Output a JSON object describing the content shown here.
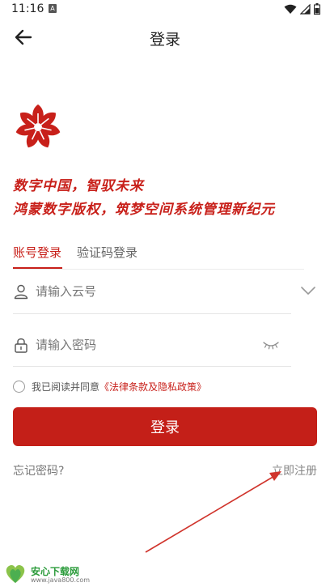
{
  "status_bar": {
    "time": "11:16",
    "notification_badge": "A"
  },
  "nav": {
    "title": "登录"
  },
  "slogan": {
    "line1": "数字中国，智驭未来",
    "line2": "鸿蒙数字版权，筑梦空间系统管理新纪元"
  },
  "tabs": [
    {
      "label": "账号登录",
      "active": true
    },
    {
      "label": "验证码登录",
      "active": false
    }
  ],
  "form": {
    "account_placeholder": "请输入云号",
    "account_value": "",
    "password_placeholder": "请输入密码",
    "password_value": ""
  },
  "agreement": {
    "checked": false,
    "prefix": "我已阅读并同意",
    "link": "《法律条款及隐私政策》"
  },
  "login_button": "登录",
  "links": {
    "forgot": "忘记密码?",
    "register": "立即注册"
  },
  "watermark": {
    "title": "安心下载网",
    "url": "www.java800.com"
  },
  "colors": {
    "accent": "#c41f18",
    "text": "#222222",
    "muted": "#777777"
  }
}
